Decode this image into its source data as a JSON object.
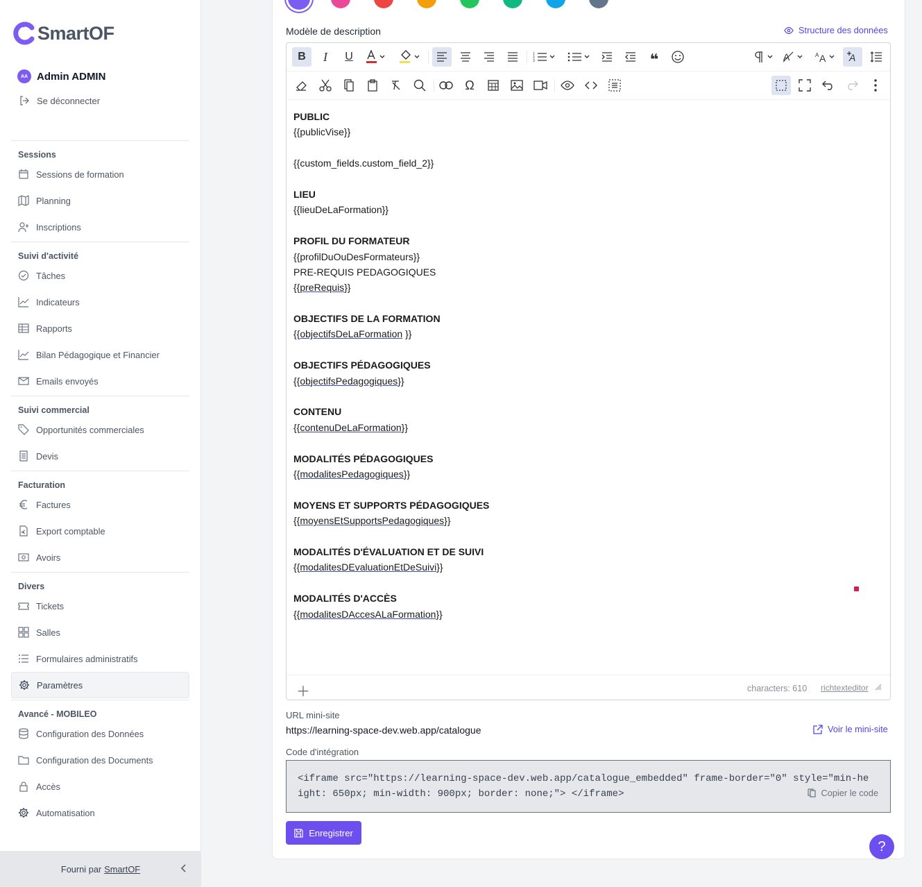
{
  "brand": {
    "name": "SmartOF",
    "accent": "#6d4ff0"
  },
  "user": {
    "initials": "AA",
    "name": "Admin ADMIN",
    "logout": "Se déconnecter"
  },
  "nav": [
    {
      "title": "Sessions",
      "items": [
        {
          "label": "Sessions de formation",
          "icon": "calendar-icon"
        },
        {
          "label": "Planning",
          "icon": "map-icon"
        },
        {
          "label": "Inscriptions",
          "icon": "user-plus-icon"
        }
      ]
    },
    {
      "title": "Suivi d'activité",
      "items": [
        {
          "label": "Tâches",
          "icon": "check-circle-icon"
        },
        {
          "label": "Indicateurs",
          "icon": "chart-line-icon"
        },
        {
          "label": "Rapports",
          "icon": "table-icon"
        },
        {
          "label": "Bilan Pédagogique et Financier",
          "icon": "chart-line-icon"
        },
        {
          "label": "Emails envoyés",
          "icon": "mail-icon"
        }
      ]
    },
    {
      "title": "Suivi commercial",
      "items": [
        {
          "label": "Opportunités commerciales",
          "icon": "tag-icon"
        },
        {
          "label": "Devis",
          "icon": "document-icon"
        }
      ]
    },
    {
      "title": "Facturation",
      "items": [
        {
          "label": "Factures",
          "icon": "euro-icon"
        },
        {
          "label": "Export comptable",
          "icon": "file-euro-icon"
        },
        {
          "label": "Avoirs",
          "icon": "cash-icon"
        }
      ]
    },
    {
      "title": "Divers",
      "items": [
        {
          "label": "Tickets",
          "icon": "ticket-icon"
        },
        {
          "label": "Salles",
          "icon": "grid-icon"
        },
        {
          "label": "Formulaires administratifs",
          "icon": "list-icon"
        },
        {
          "label": "Paramètres",
          "icon": "gear-icon",
          "active": true
        }
      ]
    },
    {
      "title": "Avancé - MOBILEO",
      "items": [
        {
          "label": "Configuration des Données",
          "icon": "database-icon"
        },
        {
          "label": "Configuration des Documents",
          "icon": "folder-icon"
        },
        {
          "label": "Accès",
          "icon": "lock-icon"
        },
        {
          "label": "Automatisation",
          "icon": "gear-icon"
        }
      ]
    }
  ],
  "footer": {
    "prefix": "Fourni par",
    "link": "SmartOF"
  },
  "swatches": [
    "#7c5cf1",
    "#ec4899",
    "#ef4444",
    "#f59e0b",
    "#22c55e",
    "#10b981",
    "#0ea5e9",
    "#64748b"
  ],
  "description": {
    "label": "Modèle de description",
    "structure_link": "Structure des données",
    "lines": [
      {
        "t": "PUBLIC",
        "b": true
      },
      {
        "t": "{{publicVise}}"
      },
      {
        "t": ""
      },
      {
        "t": "{{custom_fields.custom_field_2}}"
      },
      {
        "t": ""
      },
      {
        "t": "LIEU",
        "b": true
      },
      {
        "t": "{{lieuDeLaFormation}}"
      },
      {
        "t": ""
      },
      {
        "t": "PROFIL DU FORMATEUR",
        "b": true
      },
      {
        "t": "{{profilDuOuDesFormateurs}}"
      },
      {
        "t": "PRE-REQUIS PEDAGOGIQUES"
      },
      {
        "t": "{{preRequis}}",
        "u": "preRequis"
      },
      {
        "t": ""
      },
      {
        "t": "OBJECTIFS DE LA FORMATION",
        "b": true
      },
      {
        "t": "{{objectifsDeLaFormation }}",
        "u": "objectifsDeLaFormation"
      },
      {
        "t": ""
      },
      {
        "t": "OBJECTIFS PÉDAGOGIQUES",
        "b": true
      },
      {
        "t": "{{objectifsPedagogiques}}",
        "u": "objectifsPedagogiques"
      },
      {
        "t": ""
      },
      {
        "t": "CONTENU",
        "b": true
      },
      {
        "t": "{{contenuDeLaFormation}}",
        "u": "contenuDeLaFormation"
      },
      {
        "t": ""
      },
      {
        "t": "MODALITÉS PÉDAGOGIQUES",
        "b": true
      },
      {
        "t": "{{modalitesPedagogiques}}",
        "u": "modalitesPedagogiques"
      },
      {
        "t": ""
      },
      {
        "t": "MOYENS ET SUPPORTS PÉDAGOGIQUES",
        "b": true
      },
      {
        "t": "{{moyensEtSupportsPedagogiques}}",
        "u": "moyensEtSupportsPedagogiques"
      },
      {
        "t": ""
      },
      {
        "t": "MODALITÉS D'ÉVALUATION ET DE SUIVI",
        "b": true
      },
      {
        "t": "{{modalitesDEvaluationEtDeSuivi}}",
        "u": "modalitesDEvaluationEtDeSuivi"
      },
      {
        "t": ""
      },
      {
        "t": "MODALITÉS D'ACCÈS",
        "b": true
      },
      {
        "t": "{{modalitesDAccesALaFormation}}",
        "u": "modalitesDAccesALaFormation"
      }
    ],
    "characters": "characters: 610",
    "editor_brand": "richtexteditor"
  },
  "mini_site": {
    "label": "URL mini-site",
    "url": "https://learning-space-dev.web.app/catalogue",
    "link": "Voir le mini-site"
  },
  "embed": {
    "label": "Code d'intégration",
    "code": "<iframe src=\"https://learning-space-dev.web.app/catalogue_embedded\" frame-border=\"0\" style=\"min-height: 650px; min-width: 900px; border: none;\"> </iframe>",
    "copy": "Copier le code"
  },
  "save_label": "Enregistrer",
  "help_label": "?"
}
